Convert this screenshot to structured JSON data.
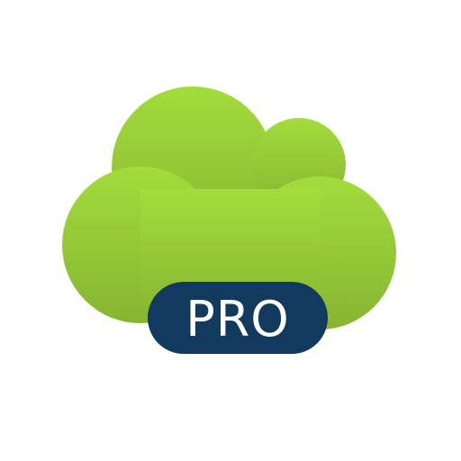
{
  "app_icon": {
    "icon_name": "cloud-icon",
    "badge_label": "PRO",
    "colors": {
      "cloud_top": "#a3dc3c",
      "cloud_bottom": "#86b531",
      "badge_bg": "#123a5e",
      "badge_text": "#ffffff",
      "background": "#ffffff"
    }
  }
}
